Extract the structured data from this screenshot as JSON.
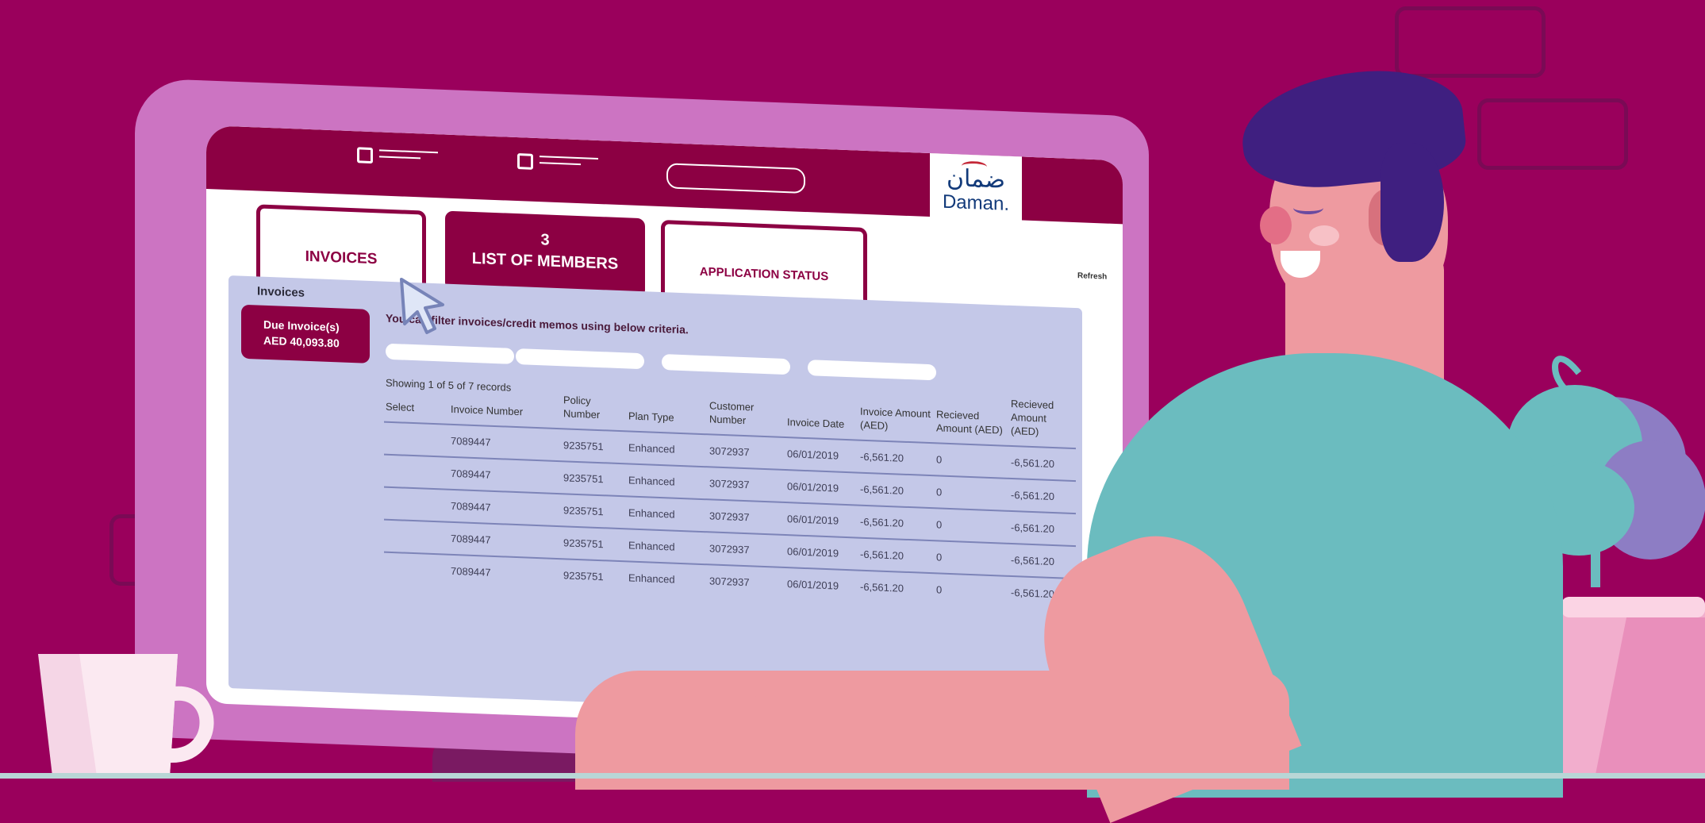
{
  "header": {
    "logo_arabic": "ضمان",
    "logo_english": "Daman."
  },
  "tabs": [
    {
      "label": "INVOICES"
    },
    {
      "badge": "3",
      "label": "LIST OF MEMBERS"
    },
    {
      "label": "APPLICATION STATUS"
    }
  ],
  "refresh_label": "Refresh",
  "panel": {
    "title": "Invoices",
    "due_label": "Due Invoice(s)",
    "due_amount": "AED 40,093.80",
    "filter_hint": "You can filter invoices/credit memos using below criteria.",
    "records_text": "Showing 1 of 5 of 7 records"
  },
  "table": {
    "columns": [
      "Select",
      "Invoice Number",
      "Policy Number",
      "Plan Type",
      "Customer Number",
      "Invoice Date",
      "Invoice Amount (AED)",
      "Recieved Amount (AED)",
      "Recieved Amount (AED)"
    ],
    "rows": [
      [
        "",
        "7089447",
        "9235751",
        "Enhanced",
        "3072937",
        "06/01/2019",
        "-6,561.20",
        "0",
        "-6,561.20"
      ],
      [
        "",
        "7089447",
        "9235751",
        "Enhanced",
        "3072937",
        "06/01/2019",
        "-6,561.20",
        "0",
        "-6,561.20"
      ],
      [
        "",
        "7089447",
        "9235751",
        "Enhanced",
        "3072937",
        "06/01/2019",
        "-6,561.20",
        "0",
        "-6,561.20"
      ],
      [
        "",
        "7089447",
        "9235751",
        "Enhanced",
        "3072937",
        "06/01/2019",
        "-6,561.20",
        "0",
        "-6,561.20"
      ],
      [
        "",
        "7089447",
        "9235751",
        "Enhanced",
        "3072937",
        "06/01/2019",
        "-6,561.20",
        "0",
        "-6,561.20"
      ]
    ]
  },
  "colors": {
    "background": "#9a005c",
    "brand": "#8c0043",
    "monitor": "#cc74c2",
    "panel": "#c4c8e8",
    "shirt": "#6bbcbf",
    "hair": "#3f1f80",
    "skin": "#ee9aa0"
  },
  "icons": [
    "cursor-arrow-icon",
    "checkbox-nav-icon",
    "coffee-cup-icon",
    "plant-icon"
  ]
}
